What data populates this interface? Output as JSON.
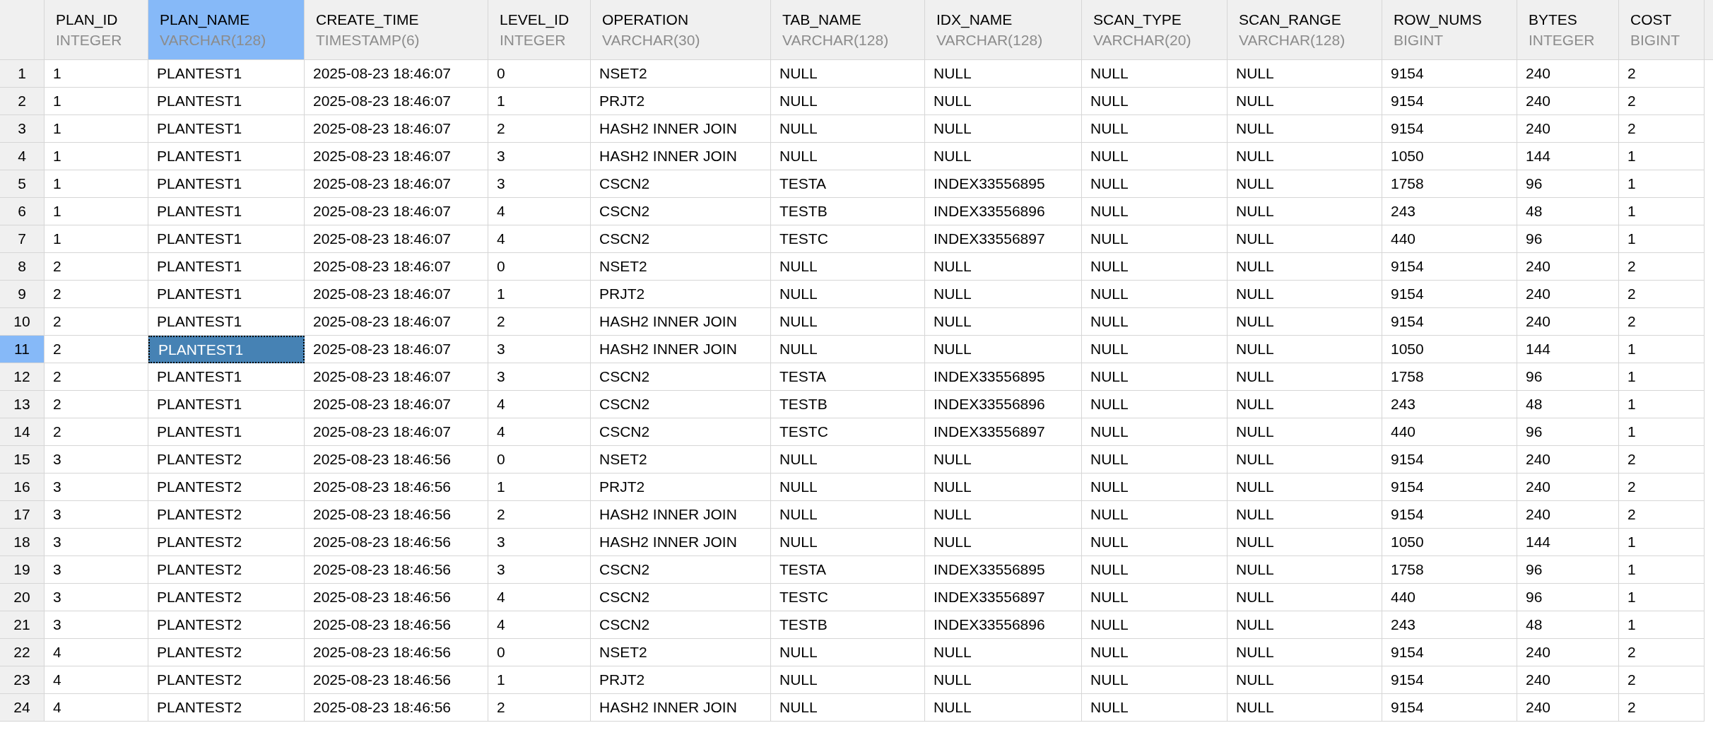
{
  "grid": {
    "columns": [
      {
        "name": "PLAN_ID",
        "type": "INTEGER",
        "selected": false
      },
      {
        "name": "PLAN_NAME",
        "type": "VARCHAR(128)",
        "selected": true
      },
      {
        "name": "CREATE_TIME",
        "type": "TIMESTAMP(6)",
        "selected": false
      },
      {
        "name": "LEVEL_ID",
        "type": "INTEGER",
        "selected": false
      },
      {
        "name": "OPERATION",
        "type": "VARCHAR(30)",
        "selected": false
      },
      {
        "name": "TAB_NAME",
        "type": "VARCHAR(128)",
        "selected": false
      },
      {
        "name": "IDX_NAME",
        "type": "VARCHAR(128)",
        "selected": false
      },
      {
        "name": "SCAN_TYPE",
        "type": "VARCHAR(20)",
        "selected": false
      },
      {
        "name": "SCAN_RANGE",
        "type": "VARCHAR(128)",
        "selected": false
      },
      {
        "name": "ROW_NUMS",
        "type": "BIGINT",
        "selected": false
      },
      {
        "name": "BYTES",
        "type": "INTEGER",
        "selected": false
      },
      {
        "name": "COST",
        "type": "BIGINT",
        "selected": false
      }
    ],
    "rows": [
      {
        "number": "1",
        "selected": false,
        "cells": [
          "1",
          "PLANTEST1",
          "2025-08-23 18:46:07",
          "0",
          "NSET2",
          "NULL",
          "NULL",
          "NULL",
          "NULL",
          "9154",
          "240",
          "2"
        ]
      },
      {
        "number": "2",
        "selected": false,
        "cells": [
          "1",
          "PLANTEST1",
          "2025-08-23 18:46:07",
          "1",
          "PRJT2",
          "NULL",
          "NULL",
          "NULL",
          "NULL",
          "9154",
          "240",
          "2"
        ]
      },
      {
        "number": "3",
        "selected": false,
        "cells": [
          "1",
          "PLANTEST1",
          "2025-08-23 18:46:07",
          "2",
          "HASH2 INNER JOIN",
          "NULL",
          "NULL",
          "NULL",
          "NULL",
          "9154",
          "240",
          "2"
        ]
      },
      {
        "number": "4",
        "selected": false,
        "cells": [
          "1",
          "PLANTEST1",
          "2025-08-23 18:46:07",
          "3",
          "HASH2 INNER JOIN",
          "NULL",
          "NULL",
          "NULL",
          "NULL",
          "1050",
          "144",
          "1"
        ]
      },
      {
        "number": "5",
        "selected": false,
        "cells": [
          "1",
          "PLANTEST1",
          "2025-08-23 18:46:07",
          "3",
          "CSCN2",
          "TESTA",
          "INDEX33556895",
          "NULL",
          "NULL",
          "1758",
          "96",
          "1"
        ]
      },
      {
        "number": "6",
        "selected": false,
        "cells": [
          "1",
          "PLANTEST1",
          "2025-08-23 18:46:07",
          "4",
          "CSCN2",
          "TESTB",
          "INDEX33556896",
          "NULL",
          "NULL",
          "243",
          "48",
          "1"
        ]
      },
      {
        "number": "7",
        "selected": false,
        "cells": [
          "1",
          "PLANTEST1",
          "2025-08-23 18:46:07",
          "4",
          "CSCN2",
          "TESTC",
          "INDEX33556897",
          "NULL",
          "NULL",
          "440",
          "96",
          "1"
        ]
      },
      {
        "number": "8",
        "selected": false,
        "cells": [
          "2",
          "PLANTEST1",
          "2025-08-23 18:46:07",
          "0",
          "NSET2",
          "NULL",
          "NULL",
          "NULL",
          "NULL",
          "9154",
          "240",
          "2"
        ]
      },
      {
        "number": "9",
        "selected": false,
        "cells": [
          "2",
          "PLANTEST1",
          "2025-08-23 18:46:07",
          "1",
          "PRJT2",
          "NULL",
          "NULL",
          "NULL",
          "NULL",
          "9154",
          "240",
          "2"
        ]
      },
      {
        "number": "10",
        "selected": false,
        "cells": [
          "2",
          "PLANTEST1",
          "2025-08-23 18:46:07",
          "2",
          "HASH2 INNER JOIN",
          "NULL",
          "NULL",
          "NULL",
          "NULL",
          "9154",
          "240",
          "2"
        ]
      },
      {
        "number": "11",
        "selected": true,
        "cells": [
          "2",
          "PLANTEST1",
          "2025-08-23 18:46:07",
          "3",
          "HASH2 INNER JOIN",
          "NULL",
          "NULL",
          "NULL",
          "NULL",
          "1050",
          "144",
          "1"
        ]
      },
      {
        "number": "12",
        "selected": false,
        "cells": [
          "2",
          "PLANTEST1",
          "2025-08-23 18:46:07",
          "3",
          "CSCN2",
          "TESTA",
          "INDEX33556895",
          "NULL",
          "NULL",
          "1758",
          "96",
          "1"
        ]
      },
      {
        "number": "13",
        "selected": false,
        "cells": [
          "2",
          "PLANTEST1",
          "2025-08-23 18:46:07",
          "4",
          "CSCN2",
          "TESTB",
          "INDEX33556896",
          "NULL",
          "NULL",
          "243",
          "48",
          "1"
        ]
      },
      {
        "number": "14",
        "selected": false,
        "cells": [
          "2",
          "PLANTEST1",
          "2025-08-23 18:46:07",
          "4",
          "CSCN2",
          "TESTC",
          "INDEX33556897",
          "NULL",
          "NULL",
          "440",
          "96",
          "1"
        ]
      },
      {
        "number": "15",
        "selected": false,
        "cells": [
          "3",
          "PLANTEST2",
          "2025-08-23 18:46:56",
          "0",
          "NSET2",
          "NULL",
          "NULL",
          "NULL",
          "NULL",
          "9154",
          "240",
          "2"
        ]
      },
      {
        "number": "16",
        "selected": false,
        "cells": [
          "3",
          "PLANTEST2",
          "2025-08-23 18:46:56",
          "1",
          "PRJT2",
          "NULL",
          "NULL",
          "NULL",
          "NULL",
          "9154",
          "240",
          "2"
        ]
      },
      {
        "number": "17",
        "selected": false,
        "cells": [
          "3",
          "PLANTEST2",
          "2025-08-23 18:46:56",
          "2",
          "HASH2 INNER JOIN",
          "NULL",
          "NULL",
          "NULL",
          "NULL",
          "9154",
          "240",
          "2"
        ]
      },
      {
        "number": "18",
        "selected": false,
        "cells": [
          "3",
          "PLANTEST2",
          "2025-08-23 18:46:56",
          "3",
          "HASH2 INNER JOIN",
          "NULL",
          "NULL",
          "NULL",
          "NULL",
          "1050",
          "144",
          "1"
        ]
      },
      {
        "number": "19",
        "selected": false,
        "cells": [
          "3",
          "PLANTEST2",
          "2025-08-23 18:46:56",
          "3",
          "CSCN2",
          "TESTA",
          "INDEX33556895",
          "NULL",
          "NULL",
          "1758",
          "96",
          "1"
        ]
      },
      {
        "number": "20",
        "selected": false,
        "cells": [
          "3",
          "PLANTEST2",
          "2025-08-23 18:46:56",
          "4",
          "CSCN2",
          "TESTC",
          "INDEX33556897",
          "NULL",
          "NULL",
          "440",
          "96",
          "1"
        ]
      },
      {
        "number": "21",
        "selected": false,
        "cells": [
          "3",
          "PLANTEST2",
          "2025-08-23 18:46:56",
          "4",
          "CSCN2",
          "TESTB",
          "INDEX33556896",
          "NULL",
          "NULL",
          "243",
          "48",
          "1"
        ]
      },
      {
        "number": "22",
        "selected": false,
        "cells": [
          "4",
          "PLANTEST2",
          "2025-08-23 18:46:56",
          "0",
          "NSET2",
          "NULL",
          "NULL",
          "NULL",
          "NULL",
          "9154",
          "240",
          "2"
        ]
      },
      {
        "number": "23",
        "selected": false,
        "cells": [
          "4",
          "PLANTEST2",
          "2025-08-23 18:46:56",
          "1",
          "PRJT2",
          "NULL",
          "NULL",
          "NULL",
          "NULL",
          "9154",
          "240",
          "2"
        ]
      },
      {
        "number": "24",
        "selected": false,
        "cells": [
          "4",
          "PLANTEST2",
          "2025-08-23 18:46:56",
          "2",
          "HASH2 INNER JOIN",
          "NULL",
          "NULL",
          "NULL",
          "NULL",
          "9154",
          "240",
          "2"
        ]
      }
    ]
  }
}
